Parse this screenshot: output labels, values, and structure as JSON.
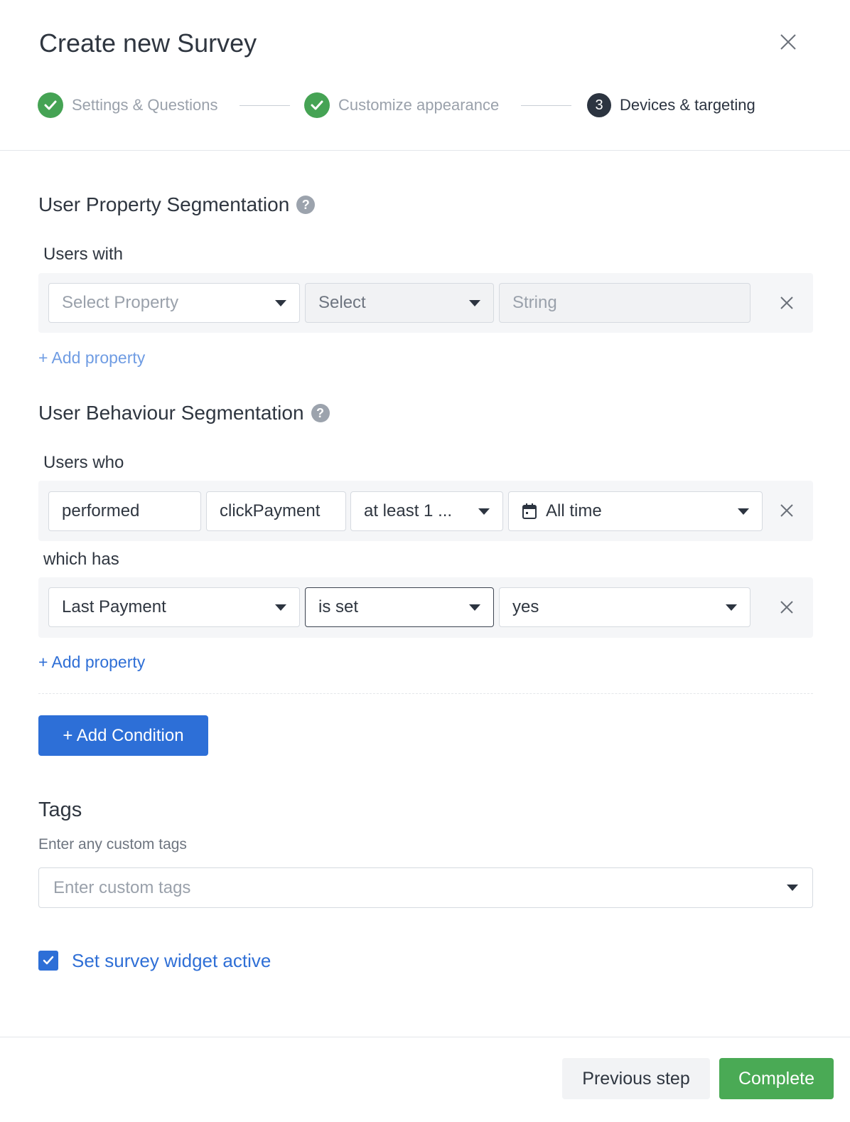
{
  "modal": {
    "title": "Create new Survey"
  },
  "steps": [
    {
      "label": "Settings & Questions",
      "status": "done"
    },
    {
      "label": "Customize appearance",
      "status": "done"
    },
    {
      "label": "Devices & targeting",
      "status": "active",
      "number": "3"
    }
  ],
  "property_segmentation": {
    "title": "User Property Segmentation",
    "help": "?",
    "users_label": "Users with",
    "property_select": "Select Property",
    "operator_select": "Select",
    "value_input": "String",
    "add_property": "+ Add property"
  },
  "behaviour_segmentation": {
    "title": "User Behaviour Segmentation",
    "help": "?",
    "users_label": "Users who",
    "action": "performed",
    "event": "clickPayment",
    "frequency": "at least 1 ...",
    "time_range": "All time",
    "which_has_label": "which has",
    "property": "Last Payment",
    "operator": "is set",
    "value": "yes",
    "add_property": "+ Add property"
  },
  "add_condition_button": "+ Add Condition",
  "tags": {
    "title": "Tags",
    "subtitle": "Enter any custom tags",
    "placeholder": "Enter custom tags"
  },
  "active_checkbox": {
    "label": "Set survey widget active",
    "checked": true
  },
  "footer": {
    "previous": "Previous step",
    "complete": "Complete"
  },
  "colors": {
    "primary": "#2d6fd7",
    "success": "#4aaa55",
    "step_done": "#45a354",
    "step_active": "#2c3440"
  },
  "icons": [
    "close-icon",
    "check-icon",
    "help-icon",
    "caret-down-icon",
    "calendar-icon",
    "checkbox-check-icon"
  ]
}
